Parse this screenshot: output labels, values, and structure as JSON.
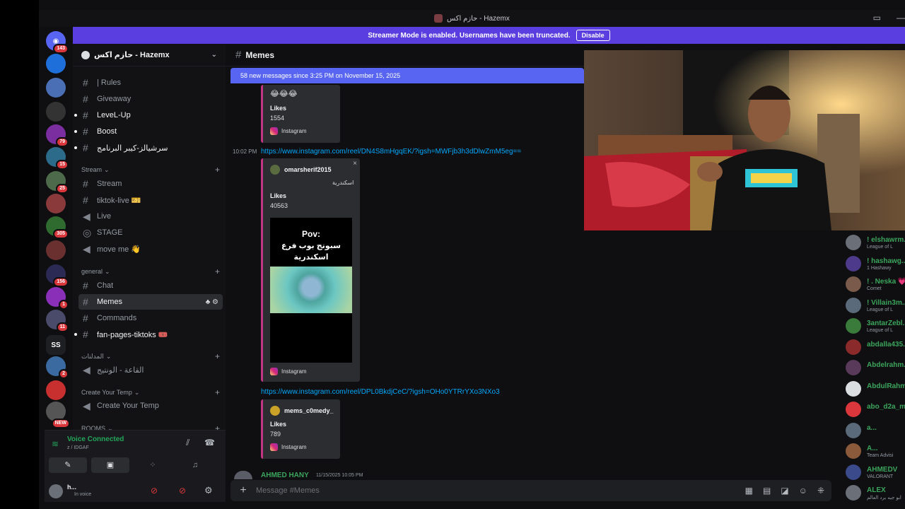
{
  "window": {
    "title": "حازم اكس - Hazemx"
  },
  "banner": {
    "text": "Streamer Mode is enabled. Usernames have been truncated.",
    "button": "Disable"
  },
  "servers": [
    {
      "icon": "discord-home-icon",
      "badge": "143",
      "color": "#5865f2"
    },
    {
      "icon": "server-icon",
      "badge": "",
      "color": "#1e6fd9"
    },
    {
      "icon": "server-icon",
      "badge": "",
      "color": "#4a6fb5"
    },
    {
      "icon": "server-icon",
      "badge": "",
      "color": "#333"
    },
    {
      "icon": "server-icon",
      "badge": "79",
      "color": "#7b2ea0"
    },
    {
      "icon": "server-icon",
      "badge": "15",
      "color": "#2d6b8a"
    },
    {
      "icon": "server-icon",
      "badge": "25",
      "color": "#4d6b4a"
    },
    {
      "icon": "server-icon",
      "badge": "",
      "color": "#8a3a3a"
    },
    {
      "icon": "server-icon",
      "badge": "305",
      "color": "#2f6a2f"
    },
    {
      "icon": "server-icon",
      "badge": "",
      "color": "#6a3030"
    },
    {
      "icon": "server-icon",
      "badge": "156",
      "color": "#2a2a55"
    },
    {
      "icon": "server-icon",
      "badge": "1",
      "color": "#8a2fb8"
    },
    {
      "icon": "server-icon",
      "badge": "11",
      "color": "#4a4a6a"
    },
    {
      "icon": "server-icon",
      "label": "SS",
      "badge": "",
      "color": "#1e1f22"
    },
    {
      "icon": "server-icon",
      "badge": "2",
      "color": "#3a6aa0"
    },
    {
      "icon": "server-icon",
      "badge": "",
      "color": "#c83030"
    },
    {
      "icon": "server-icon",
      "badge": "NEW",
      "color": "#555"
    }
  ],
  "guild": {
    "name": "حازم اكس - Hazemx"
  },
  "channels": {
    "top": [
      {
        "name": "| Rules",
        "unread": false
      },
      {
        "name": "Giveaway",
        "unread": false
      },
      {
        "name": "LeveL-Up",
        "unread": true
      },
      {
        "name": "Boost",
        "unread": true
      },
      {
        "name": "سرشيالز-كيبر البرنامج",
        "unread": true
      }
    ],
    "stream_cat": "Stream",
    "stream": [
      {
        "name": "Stream",
        "type": "text"
      },
      {
        "name": "tiktok-live 🎫",
        "type": "text"
      },
      {
        "name": "Live",
        "type": "voice"
      },
      {
        "name": "STAGE",
        "type": "stage"
      },
      {
        "name": "move me 👋",
        "type": "voice"
      }
    ],
    "general_cat": "general",
    "general": [
      {
        "name": "Chat",
        "unread": false
      },
      {
        "name": "Memes",
        "selected": true
      },
      {
        "name": "Commands",
        "unread": false
      },
      {
        "name": "fan-pages-tiktoks 🎟️",
        "unread": true
      }
    ],
    "mod_cat": "المدلنات",
    "mod": [
      {
        "name": "القاعة - الونتيج"
      }
    ],
    "temp_cat": "Create Your Temp",
    "temp": [
      {
        "name": "Create Your Temp"
      }
    ],
    "rooms_cat": "ROOMS"
  },
  "voice": {
    "status": "Voice Connected",
    "location": "z / IDGAF"
  },
  "user": {
    "name": "h...",
    "status": "In voice"
  },
  "chat": {
    "channel": "Memes",
    "new_messages": "58 new messages since 3:25 PM on November 15, 2025",
    "embed1": {
      "emoji": "😂😂😂",
      "likes_label": "Likes",
      "likes": "1554",
      "source": "Instagram"
    },
    "msg2": {
      "time": "10:02 PM",
      "link": "https://www.instagram.com/reel/DN4S8mHgqEK/?igsh=MWFjb3h3dDlwZmM5eg=="
    },
    "embed2": {
      "author": "omarsherif2015",
      "desc": "اسكندرية",
      "likes_label": "Likes",
      "likes": "40563",
      "video_top": "Pov:",
      "video_arabic": "سبونج بوب فرع اسكندرية",
      "source": "Instagram"
    },
    "msg3": {
      "link": "https://www.instagram.com/reel/DPL0BkdjCeC/?igsh=OHo0YTRrYXo3NXo3"
    },
    "embed3": {
      "author": "mems_c0medy_",
      "likes_label": "Likes",
      "likes": "789",
      "source": "Instagram"
    },
    "msg4": {
      "author": "AHMED HANY",
      "time": "11/15/2025 10:05 PM"
    },
    "composer_placeholder": "Message #Memes"
  },
  "members": [
    {
      "name": "! elshawrm...",
      "sub": "League of L",
      "color": "#3ba55c"
    },
    {
      "name": "! hashawg...",
      "sub": "1 Hashawy",
      "color": "#3ba55c"
    },
    {
      "name": "! . Neska 💗",
      "sub": "Comet",
      "color": "#3ba55c"
    },
    {
      "name": "! Villain3m...",
      "sub": "League of L",
      "color": "#3ba55c"
    },
    {
      "name": "3antarZebl...",
      "sub": "League of L",
      "color": "#3ba55c"
    },
    {
      "name": "abdalla435...",
      "sub": "",
      "color": "#3ba55c"
    },
    {
      "name": "Abdelrahm...",
      "sub": "",
      "color": "#3ba55c"
    },
    {
      "name": "AbdulRahm...",
      "sub": "",
      "color": "#3ba55c"
    },
    {
      "name": "abo_d2a_m...",
      "sub": "",
      "color": "#3ba55c"
    },
    {
      "name": "a...",
      "sub": "",
      "color": "#3ba55c"
    },
    {
      "name": "A...",
      "sub": "Team Advisi",
      "color": "#3ba55c"
    },
    {
      "name": "AHMEDV",
      "sub": "VALORANT",
      "color": "#3ba55c"
    },
    {
      "name": "ALEX",
      "sub": "ابو جبه برد العالم",
      "color": "#3ba55c"
    }
  ]
}
